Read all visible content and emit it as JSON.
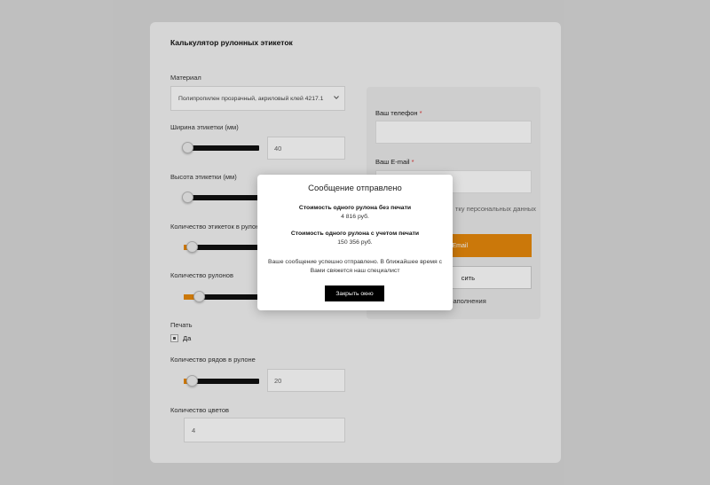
{
  "calculator": {
    "title": "Калькулятор рулонных этикеток",
    "material": {
      "label": "Материал",
      "selected": "Полипропилен прозрачный, акриловый клей 4217.1"
    },
    "width": {
      "label": "Ширина этикетки (мм)",
      "value": "40",
      "slider_fraction": 0.05
    },
    "height": {
      "label": "Высота этикетки (мм)",
      "slider_fraction": 0.05
    },
    "labels_per_roll": {
      "label": "Количество этикеток в рулоне",
      "slider_fraction": 0.1
    },
    "rolls": {
      "label": "Количество рулонов",
      "slider_fraction": 0.2
    },
    "print": {
      "label": "Печать",
      "option": "Да",
      "checked": true
    },
    "rows_per_roll": {
      "label": "Количество рядов в рулоне",
      "value": "20",
      "slider_fraction": 0.1
    },
    "colors": {
      "label": "Количество цветов",
      "value": "4"
    }
  },
  "contact_form": {
    "phone_label": "Ваш телефон",
    "email_label": "Ваш E-mail",
    "required_mark": "*",
    "consent_fragment": "тку персональных данных",
    "email_button_fragment": "ебе на Email",
    "submit_fragment": "сить",
    "fill_hint_fragment": "заполнения"
  },
  "modal": {
    "title": "Сообщение отправлено",
    "cost_no_print_label": "Стоимость одного рулона без печати",
    "cost_no_print_value": "4 816 руб.",
    "cost_with_print_label": "Стоимость одного рулона с учетом печати",
    "cost_with_print_value": "150 356 руб.",
    "message": "Ваше сообщение успешно отправлено. В ближайшее время с Вами свяжется наш специалист",
    "close_button": "Закрыть окно"
  },
  "colors": {
    "accent": "#e8890c",
    "track": "#111111",
    "panel": "#f4f4f4",
    "backdrop": "#d9d9d9"
  },
  "icons": {
    "select_arrow": "chevron-down-icon",
    "checkbox": "checkbox-icon"
  }
}
